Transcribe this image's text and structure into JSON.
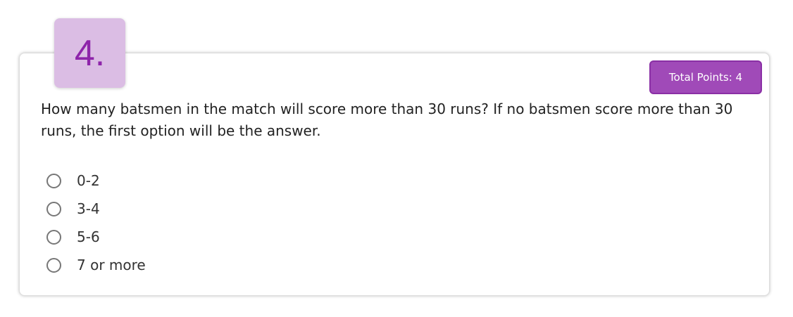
{
  "question": {
    "number": "4.",
    "total_points": "Total Points: 4",
    "text": "How many batsmen in the match will score more than 30 runs? If no batsmen score more than 30 runs, the first option will be the answer.",
    "options": [
      "0-2",
      "3-4",
      "5-6",
      "7 or more"
    ],
    "accent": "#a04ab8"
  }
}
